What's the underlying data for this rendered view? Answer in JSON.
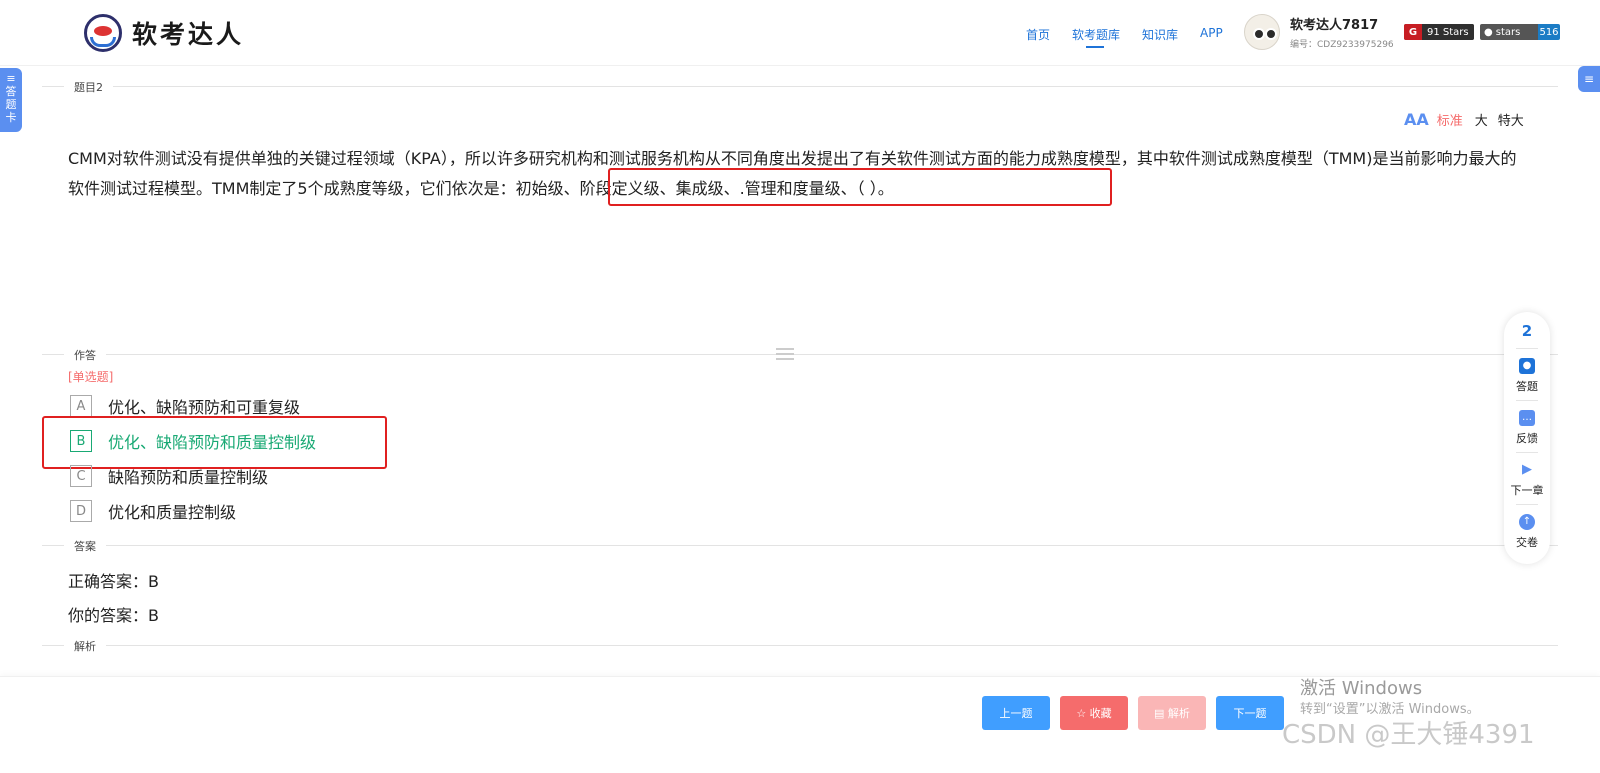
{
  "header": {
    "logo_text": "软考达人",
    "nav": [
      "首页",
      "软考题库",
      "知识库",
      "APP"
    ],
    "active_nav": 1,
    "user_name": "软考达人7817",
    "user_id": "编号：CDZ9233975296",
    "gitee_badge": "91 Stars",
    "github_label": "stars",
    "github_count": "516"
  },
  "side": {
    "left_tab": "答题卡",
    "right_tab_icon": "≡"
  },
  "sections": {
    "question_label": "题目2",
    "work_label": "作答",
    "answer_label": "答案",
    "analysis_label": "解析"
  },
  "font_size": {
    "icon": "AA",
    "standard": "标准",
    "large": "大",
    "xlarge": "特大"
  },
  "question": {
    "text": "CMM对软件测试没有提供单独的关键过程领域（KPA），所以许多研究机构和测试服务机构从不同角度出发提出了有关软件测试方面的能力成熟度模型，其中软件测试成熟度模型（TMM)是当前影响力最大的软件测试过程模型。TMM制定了5个成熟度等级，它们依次是：初始级、阶段定义级、集成级、.管理和度量级、（ ）。",
    "type": "[单选题]"
  },
  "options": [
    {
      "letter": "A",
      "text": "优化、缺陷预防和可重复级",
      "correct": false
    },
    {
      "letter": "B",
      "text": "优化、缺陷预防和质量控制级",
      "correct": true
    },
    {
      "letter": "C",
      "text": "缺陷预防和质量控制级",
      "correct": false
    },
    {
      "letter": "D",
      "text": "优化和质量控制级",
      "correct": false
    }
  ],
  "answer": {
    "correct": "正确答案：B",
    "yours": "你的答案：B"
  },
  "float_panel": {
    "current": "2",
    "items": [
      {
        "label": "答题",
        "icon": "answer-icon"
      },
      {
        "label": "反馈",
        "icon": "feedback-icon"
      },
      {
        "label": "下一章",
        "icon": "next-chapter-icon"
      },
      {
        "label": "交卷",
        "icon": "submit-icon"
      }
    ]
  },
  "buttons": {
    "prev": "上一题",
    "favorite": "☆ 收藏",
    "analysis": "▤ 解析",
    "next": "下一题"
  },
  "watermark": {
    "line1": "激活 Windows",
    "line2": "转到“设置”以激活 Windows。",
    "csdn": "CSDN @王大锤4391"
  },
  "colors": {
    "accent": "#1e73d8",
    "correct": "#19a974",
    "danger": "#f56c6c",
    "highlight_box": "#e02020"
  }
}
